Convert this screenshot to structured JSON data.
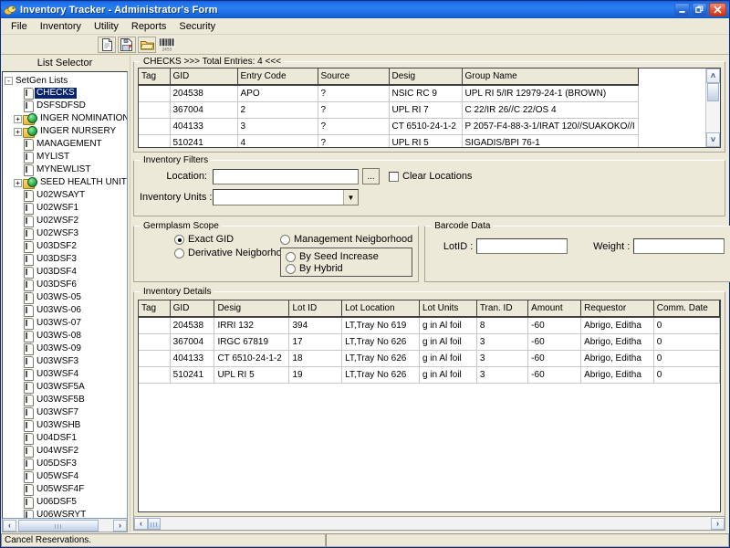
{
  "window": {
    "title": "Inventory Tracker - Administrator's Form",
    "icon": "app-inventory-icon",
    "minimize_label": "_",
    "maximize_label": "❐",
    "close_label": "✕"
  },
  "menubar": {
    "items": [
      {
        "label": "File"
      },
      {
        "label": "Inventory"
      },
      {
        "label": "Utility"
      },
      {
        "label": "Reports"
      },
      {
        "label": "Security"
      }
    ]
  },
  "toolbar": {
    "buttons": [
      {
        "name": "new-document-icon",
        "label": ""
      },
      {
        "name": "save-document-icon",
        "label": ""
      },
      {
        "name": "open-folder-icon",
        "label": ""
      },
      {
        "name": "barcode-icon",
        "label": ""
      }
    ]
  },
  "sidebar": {
    "header": "List Selector",
    "root": {
      "label": "SetGen Lists",
      "expander": "-"
    },
    "items": [
      {
        "label": "CHECKS",
        "icon": "list-icon",
        "expander": "",
        "selected": true
      },
      {
        "label": "DSFSDFSD",
        "icon": "list-icon",
        "expander": "",
        "selected": false
      },
      {
        "label": "INGER NOMINATION LI:",
        "icon": "folder-icon",
        "expander": "+",
        "selected": false
      },
      {
        "label": "INGER NURSERY",
        "icon": "folder-icon",
        "expander": "+",
        "selected": false
      },
      {
        "label": "MANAGEMENT",
        "icon": "list-icon",
        "expander": "",
        "selected": false
      },
      {
        "label": "MYLIST",
        "icon": "list-icon",
        "expander": "",
        "selected": false
      },
      {
        "label": "MYNEWLIST",
        "icon": "list-icon",
        "expander": "",
        "selected": false
      },
      {
        "label": "SEED HEALTH UNIT",
        "icon": "folder-icon",
        "expander": "+",
        "selected": false
      },
      {
        "label": "U02WSAYT",
        "icon": "list-icon",
        "expander": "",
        "selected": false
      },
      {
        "label": "U02WSF1",
        "icon": "list-icon",
        "expander": "",
        "selected": false
      },
      {
        "label": "U02WSF2",
        "icon": "list-icon",
        "expander": "",
        "selected": false
      },
      {
        "label": "U02WSF3",
        "icon": "list-icon",
        "expander": "",
        "selected": false
      },
      {
        "label": "U03DSF2",
        "icon": "list-icon",
        "expander": "",
        "selected": false
      },
      {
        "label": "U03DSF3",
        "icon": "list-icon",
        "expander": "",
        "selected": false
      },
      {
        "label": "U03DSF4",
        "icon": "list-icon",
        "expander": "",
        "selected": false
      },
      {
        "label": "U03DSF6",
        "icon": "list-icon",
        "expander": "",
        "selected": false
      },
      {
        "label": "U03WS-05",
        "icon": "list-icon",
        "expander": "",
        "selected": false
      },
      {
        "label": "U03WS-06",
        "icon": "list-icon",
        "expander": "",
        "selected": false
      },
      {
        "label": "U03WS-07",
        "icon": "list-icon",
        "expander": "",
        "selected": false
      },
      {
        "label": "U03WS-08",
        "icon": "list-icon",
        "expander": "",
        "selected": false
      },
      {
        "label": "U03WS-09",
        "icon": "list-icon",
        "expander": "",
        "selected": false
      },
      {
        "label": "U03WSF3",
        "icon": "list-icon",
        "expander": "",
        "selected": false
      },
      {
        "label": "U03WSF4",
        "icon": "list-icon",
        "expander": "",
        "selected": false
      },
      {
        "label": "U03WSF5A",
        "icon": "list-icon",
        "expander": "",
        "selected": false
      },
      {
        "label": "U03WSF5B",
        "icon": "list-icon",
        "expander": "",
        "selected": false
      },
      {
        "label": "U03WSF7",
        "icon": "list-icon",
        "expander": "",
        "selected": false
      },
      {
        "label": "U03WSHB",
        "icon": "list-icon",
        "expander": "",
        "selected": false
      },
      {
        "label": "U04DSF1",
        "icon": "list-icon",
        "expander": "",
        "selected": false
      },
      {
        "label": "U04WSF2",
        "icon": "list-icon",
        "expander": "",
        "selected": false
      },
      {
        "label": "U05DSF3",
        "icon": "list-icon",
        "expander": "",
        "selected": false
      },
      {
        "label": "U05WSF4",
        "icon": "list-icon",
        "expander": "",
        "selected": false
      },
      {
        "label": "U05WSF4F",
        "icon": "list-icon",
        "expander": "",
        "selected": false
      },
      {
        "label": "U06DSF5",
        "icon": "list-icon",
        "expander": "",
        "selected": false
      },
      {
        "label": "U06WSRYT",
        "icon": "list-icon",
        "expander": "",
        "selected": false
      }
    ]
  },
  "checks_panel": {
    "title": "CHECKS >>> Total Entries: 4 <<<",
    "columns": [
      "Tag",
      "GID",
      "Entry Code",
      "Source",
      "Desig",
      "Group Name"
    ],
    "rows": [
      [
        "",
        "204538",
        "APO",
        "?",
        "NSIC RC 9",
        "UPL RI 5/IR 12979-24-1 (BROWN)"
      ],
      [
        "",
        "367004",
        "2",
        "?",
        "UPL RI 7",
        "C 22/IR 26//C 22/OS 4"
      ],
      [
        "",
        "404133",
        "3",
        "?",
        "CT 6510-24-1-2",
        "P 2057-F4-88-3-1/IRAT 120//SUAKOKO//I"
      ],
      [
        "",
        "510241",
        "4",
        "?",
        "UPL RI 5",
        "SIGADIS/BPI 76-1"
      ]
    ]
  },
  "filters": {
    "title": "Inventory Filters",
    "location_label": "Location:",
    "location_value": "",
    "browse_label": "...",
    "clear_locations_label": "Clear Locations",
    "clear_locations_checked": false,
    "units_label": "Inventory Units :",
    "units_value": ""
  },
  "germplasm_scope": {
    "title": "Germplasm Scope",
    "options": [
      {
        "label": "Exact GID",
        "selected": true
      },
      {
        "label": "Derivative Neigborhood",
        "selected": false
      }
    ],
    "management": {
      "label": "Management Neigborhood",
      "selected": false
    },
    "sub_options": [
      {
        "label": "By Seed Increase",
        "selected": false
      },
      {
        "label": "By Hybrid",
        "selected": false
      }
    ]
  },
  "barcode_data": {
    "title": "Barcode Data",
    "lotid_label": "LotID :",
    "lotid_value": "",
    "weight_label": "Weight :",
    "weight_value": ""
  },
  "details_panel": {
    "title": "Inventory Details",
    "columns": [
      "Tag",
      "GID",
      "Desig",
      "Lot ID",
      "Lot Location",
      "Lot Units",
      "Tran. ID",
      "Amount",
      "Requestor",
      "Comm. Date"
    ],
    "rows": [
      [
        "",
        "204538",
        "IRRI 132",
        "394",
        "LT,Tray No 619",
        "g in Al foil",
        "8",
        "-60",
        "Abrigo, Editha",
        "0"
      ],
      [
        "",
        "367004",
        "IRGC 67819",
        "17",
        "LT,Tray No 626",
        "g in Al foil",
        "3",
        "-60",
        "Abrigo, Editha",
        "0"
      ],
      [
        "",
        "404133",
        "CT 6510-24-1-2",
        "18",
        "LT,Tray No 626",
        "g in Al foil",
        "3",
        "-60",
        "Abrigo, Editha",
        "0"
      ],
      [
        "",
        "510241",
        "UPL RI 5",
        "19",
        "LT,Tray No 626",
        "g in Al foil",
        "3",
        "-60",
        "Abrigo, Editha",
        "0"
      ]
    ]
  },
  "statusbar": {
    "message": "Cancel Reservations.",
    "secondary": ""
  },
  "scrollbars": {
    "left_arrow": "‹",
    "right_arrow": "›",
    "up_arrow": "˄",
    "down_arrow": "˅"
  },
  "colors": {
    "titlebar_blue": "#1d6ee8",
    "face": "#ece9d8",
    "selection": "#0a246a",
    "grid_line": "#c8c8c8"
  }
}
